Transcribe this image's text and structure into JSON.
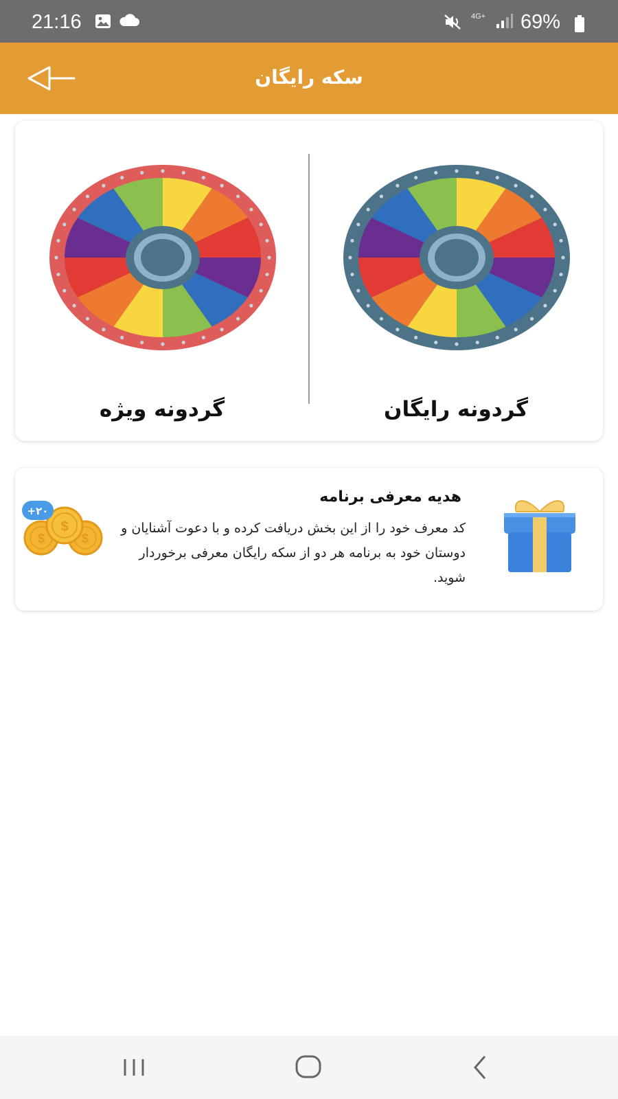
{
  "status_bar": {
    "time": "21:16",
    "network": "4G+",
    "battery": "69%",
    "icons": [
      "image-icon",
      "cloud-icon",
      "mute-icon",
      "signal-icon",
      "battery-icon"
    ]
  },
  "app_bar": {
    "title": "سکه رایگان",
    "back_icon": "back-arrow-icon",
    "color": "#e39b33"
  },
  "wheels": {
    "free_label": "گردونه رایگان",
    "special_label": "گردونه ویژه",
    "free_rim_color": "#4d7388",
    "special_rim_color": "#de5d5a",
    "segment_colors": [
      "#f7d640",
      "#ee7a2f",
      "#e23b33",
      "#6a2e91",
      "#2f6fbe",
      "#8cc04e"
    ]
  },
  "referral": {
    "title": "هدیه معرفی برنامه",
    "description": "کد معرف خود را از این بخش دریافت کرده و با دعوت آشنایان و دوستان خود به برنامه هر دو از سکه رایگان معرفی برخوردار شوید.",
    "badge": "+۲۰",
    "gift_icon": "gift-icon",
    "coins_icon": "coins-icon"
  },
  "nav_bar": {
    "items": [
      "recent-apps-icon",
      "home-icon",
      "back-icon"
    ]
  }
}
